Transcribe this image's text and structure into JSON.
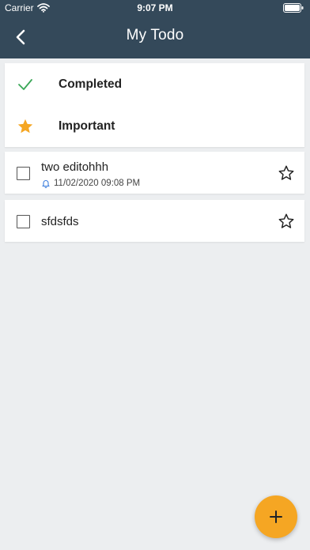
{
  "status_bar": {
    "carrier": "Carrier",
    "time": "9:07 PM"
  },
  "nav": {
    "title": "My Todo",
    "back_icon": "chevron-left-icon"
  },
  "filters": [
    {
      "label": "Completed",
      "icon": "check-icon",
      "icon_color": "#3aa757"
    },
    {
      "label": "Important",
      "icon": "star-filled-icon",
      "icon_color": "#f5a623"
    }
  ],
  "tasks": [
    {
      "title": "two editohhh",
      "reminder": "11/02/2020 09:08 PM",
      "completed": false,
      "important": false
    },
    {
      "title": "sfdsfds",
      "completed": false,
      "important": false
    }
  ],
  "fab": {
    "icon": "plus-icon",
    "color": "#f5a623"
  },
  "colors": {
    "header": "#34495a",
    "background": "#eceef0",
    "reminder_icon": "#3b7ddd"
  }
}
